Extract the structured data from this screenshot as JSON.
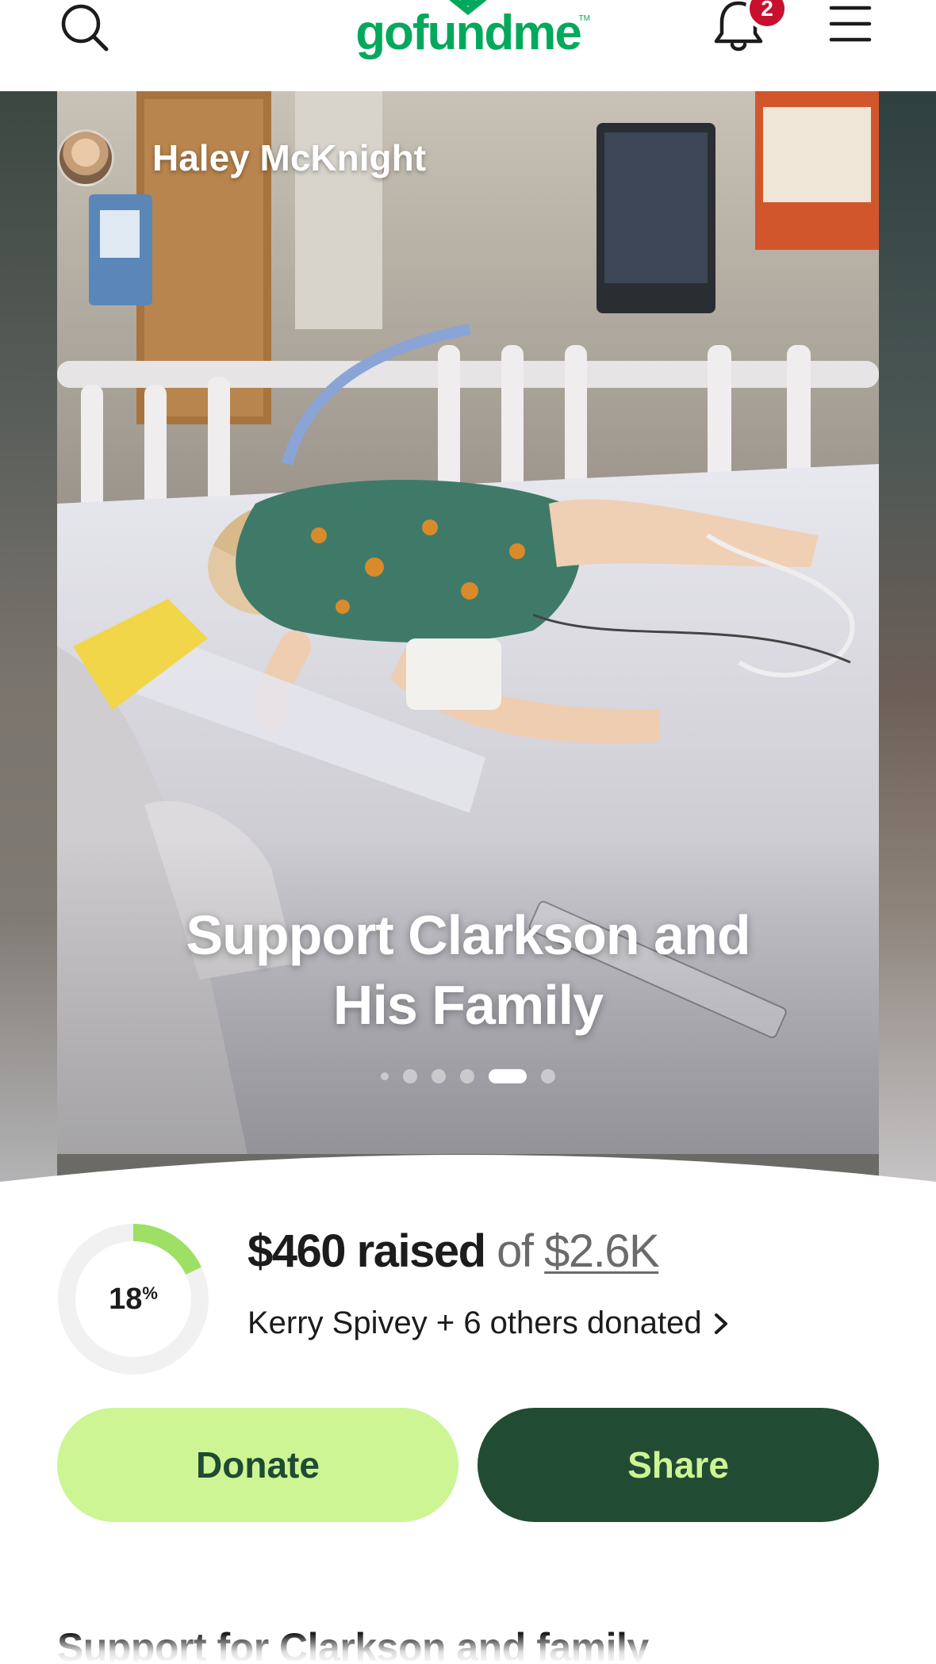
{
  "nav": {
    "logo_text": "gofundme",
    "notification_count": "2",
    "icons": [
      "search-icon",
      "bell-icon",
      "hamburger-menu-icon"
    ]
  },
  "hero": {
    "author_name": "Haley McKnight",
    "title_line1": "Support Clarkson and",
    "title_line2": "His Family",
    "carousel_total": 6,
    "carousel_active": 5
  },
  "stats": {
    "percent": "18",
    "percent_sign": "%",
    "percent_value": 0.18,
    "raised_amount": "$460 raised",
    "raised_of": "of",
    "goal": "$2.6K",
    "donors_text": "Kerry Spivey + 6 others donated"
  },
  "actions": {
    "donate_label": "Donate",
    "share_label": "Share"
  },
  "section": {
    "title": "Support for Clarkson and family"
  },
  "colors": {
    "brand_green": "#02a95c",
    "donate_bg": "#cdf594",
    "share_bg": "#224b34",
    "badge_red": "#c8102e",
    "progress_green": "#9ee065"
  }
}
